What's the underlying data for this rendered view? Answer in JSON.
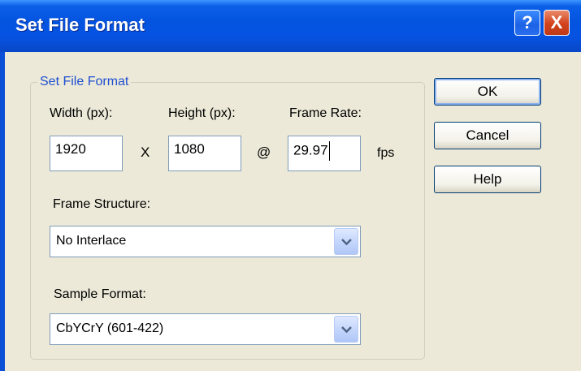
{
  "window": {
    "title": "Set File Format",
    "help_glyph": "?",
    "close_glyph": "X"
  },
  "group": {
    "legend": "Set File Format",
    "width_label": "Width (px):",
    "height_label": "Height (px):",
    "frame_rate_label": "Frame Rate:",
    "width_value": "1920",
    "height_value": "1080",
    "frame_rate_value": "29.97",
    "times_symbol": "X",
    "at_symbol": "@",
    "fps_label": "fps",
    "frame_structure_label": "Frame Structure:",
    "frame_structure_value": "No Interlace",
    "sample_format_label": "Sample Format:",
    "sample_format_value": "CbYCrY (601-422)"
  },
  "buttons": {
    "ok": "OK",
    "cancel": "Cancel",
    "help": "Help"
  },
  "icons": {
    "dropdown": "chevron-down-icon",
    "help": "help-icon",
    "close": "close-icon"
  },
  "colors": {
    "titlebar": "#0454e0",
    "legend_text": "#1f4fd0",
    "dialog_bg": "#ece9d8",
    "close_button": "#d2411c"
  }
}
